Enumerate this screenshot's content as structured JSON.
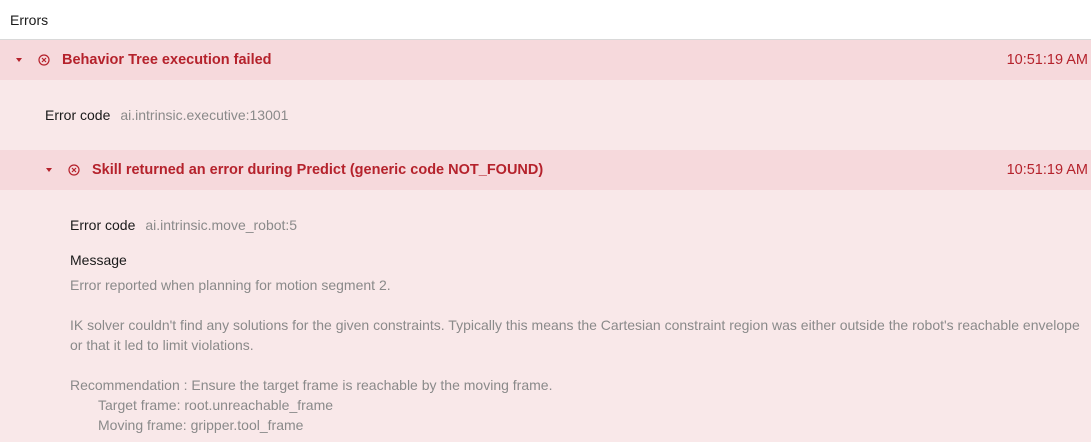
{
  "panel": {
    "title": "Errors"
  },
  "colors": {
    "error_red": "#b5222c",
    "row_bg": "#f6d9dc",
    "body_bg": "#f9e8e9"
  },
  "errors": [
    {
      "title": "Behavior Tree execution failed",
      "time": "10:51:19 AM",
      "error_code_label": "Error code",
      "error_code": "ai.intrinsic.executive:13001"
    },
    {
      "title": "Skill returned an error during Predict (generic code NOT_FOUND)",
      "time": "10:51:19 AM",
      "error_code_label": "Error code",
      "error_code": "ai.intrinsic.move_robot:5",
      "message_label": "Message",
      "message": {
        "line1": "Error reported when planning for motion segment 2.",
        "line2": "IK solver couldn't find any solutions for the given constraints. Typically this means the Cartesian constraint region was either outside the robot's reachable envelope or that it led to limit violations.",
        "recommendation": "Recommendation : Ensure the target frame is reachable by the moving frame.",
        "target_frame": "Target frame: root.unreachable_frame",
        "moving_frame": "Moving frame: gripper.tool_frame"
      }
    }
  ]
}
